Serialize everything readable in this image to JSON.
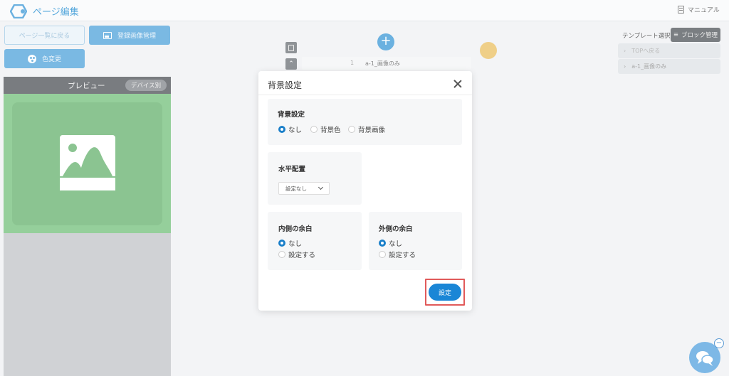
{
  "header": {
    "title": "ページ編集",
    "manual_label": "マニュアル"
  },
  "left_panel": {
    "back_button": "ページ一覧に戻る",
    "image_manage_button": "登録画像管理",
    "color_change_button": "色変更",
    "preview_title": "プレビュー",
    "device_button": "デバイス別"
  },
  "center": {
    "block_number": "1",
    "block_name": "a-1_画像のみ"
  },
  "right_panel": {
    "template_label": "テンプレート選択",
    "block_manage_button": "ブロック管理",
    "items": [
      {
        "label": "TOPへ戻る"
      },
      {
        "label": "a-1_画像のみ"
      }
    ]
  },
  "modal": {
    "title": "背景設定",
    "background_section": {
      "label": "背景設定",
      "options": [
        {
          "label": "なし",
          "checked": true
        },
        {
          "label": "背景色",
          "checked": false
        },
        {
          "label": "背景画像",
          "checked": false
        }
      ]
    },
    "align_section": {
      "label": "水平配置",
      "selected": "設定なし"
    },
    "inner_margin_section": {
      "label": "内側の余白",
      "options": [
        {
          "label": "なし",
          "checked": true
        },
        {
          "label": "設定する",
          "checked": false
        }
      ]
    },
    "outer_margin_section": {
      "label": "外側の余白",
      "options": [
        {
          "label": "なし",
          "checked": true
        },
        {
          "label": "設定する",
          "checked": false
        }
      ]
    },
    "submit_button": "設定"
  },
  "colors": {
    "accent": "#1a86d6",
    "highlight_border": "#e15a5a",
    "preview_bg": "#95cf9b"
  }
}
